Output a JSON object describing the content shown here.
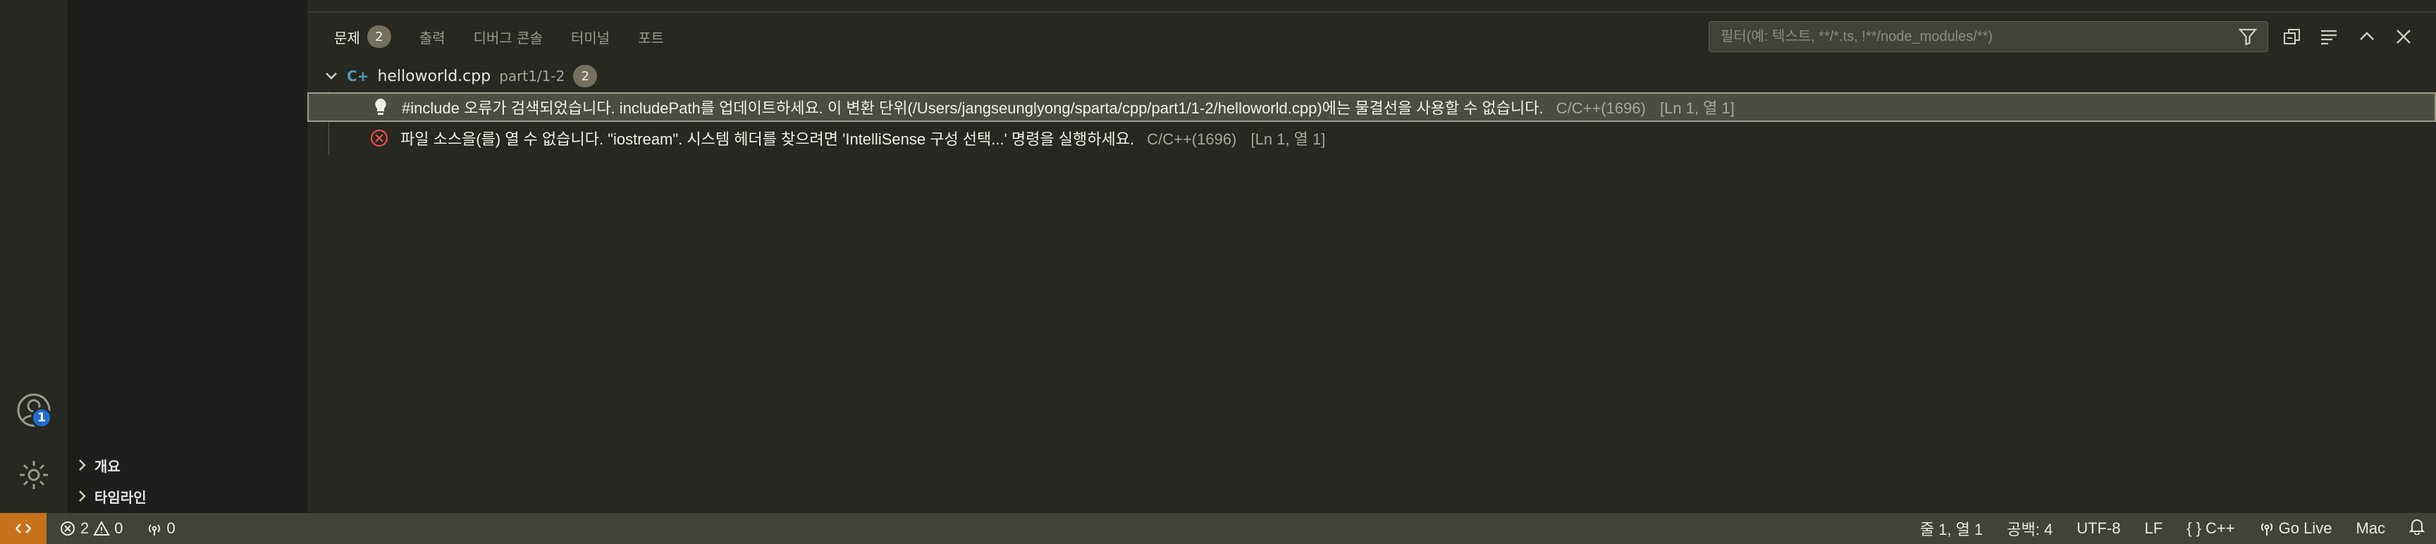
{
  "sidebar": {
    "outline_label": "개요",
    "timeline_label": "타임라인",
    "account_badge": "1"
  },
  "panel": {
    "tabs": [
      {
        "label": "문제",
        "badge": "2"
      },
      {
        "label": "출력"
      },
      {
        "label": "디버그 콘솔"
      },
      {
        "label": "터미널"
      },
      {
        "label": "포트"
      }
    ],
    "filter_placeholder": "필터(예: 텍스트, **/*.ts, !**/node_modules/**)"
  },
  "problems": {
    "file": {
      "name": "helloworld.cpp",
      "path": "part1/1-2",
      "count": "2"
    },
    "items": [
      {
        "icon": "lightbulb-icon",
        "message": "#include 오류가 검색되었습니다. includePath를 업데이트하세요. 이 변환 단위(/Users/jangseunglyong/sparta/cpp/part1/1-2/helloworld.cpp)에는 물결선을 사용할 수 없습니다.",
        "source": "C/C++(1696)",
        "position": "[Ln 1, 열 1]"
      },
      {
        "icon": "error-icon",
        "message": "파일 소스을(를) 열 수 없습니다. \"iostream\". 시스템 헤더를 찾으려면 'IntelliSense 구성 선택...' 명령을 실행하세요.",
        "source": "C/C++(1696)",
        "position": "[Ln 1, 열 1]"
      }
    ]
  },
  "statusbar": {
    "errors": "2",
    "warnings": "0",
    "ports": "0",
    "cursor": "줄 1, 열 1",
    "indent": "공백: 4",
    "encoding": "UTF-8",
    "eol": "LF",
    "language": "C++",
    "golive": "Go Live",
    "platform": "Mac"
  },
  "colors": {
    "background": "#272822",
    "statusbar": "#414339",
    "remote": "#c8711d",
    "error": "#f14c4c",
    "badge": "#1f6fd1"
  }
}
